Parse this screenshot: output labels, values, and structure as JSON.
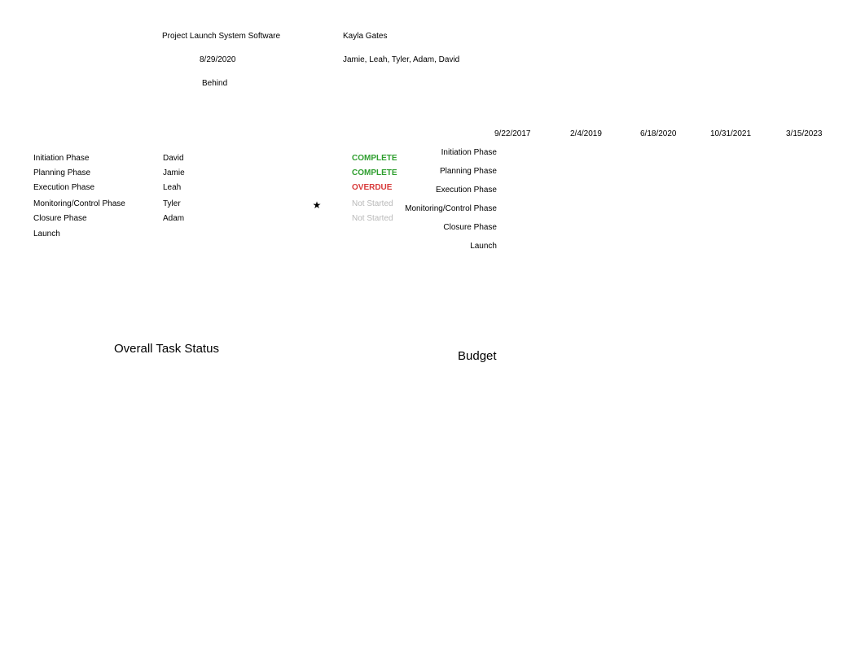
{
  "header": {
    "project_name": "Project Launch System Software",
    "project_date": "8/29/2020",
    "status_label": "Behind",
    "lead": "Kayla Gates",
    "team": "Jamie, Leah, Tyler, Adam, David"
  },
  "tasks": [
    {
      "phase": "Initiation Phase",
      "owner": "David",
      "risk": "",
      "status": "COMPLETE",
      "status_class": "status-complete"
    },
    {
      "phase": "Planning Phase",
      "owner": "Jamie",
      "risk": "",
      "status": "COMPLETE",
      "status_class": "status-complete"
    },
    {
      "phase": "Execution Phase",
      "owner": "Leah",
      "risk": "",
      "status": "OVERDUE",
      "status_class": "status-overdue"
    },
    {
      "phase": "Monitoring/Control Phase",
      "owner": "Tyler",
      "risk": "★",
      "status": "Not Started",
      "status_class": "status-notstarted"
    },
    {
      "phase": "Closure Phase",
      "owner": "Adam",
      "risk": "",
      "status": "Not Started",
      "status_class": "status-notstarted"
    },
    {
      "phase": "Launch",
      "owner": "",
      "risk": "",
      "status": "",
      "status_class": ""
    }
  ],
  "timeline": {
    "dates": [
      "9/22/2017",
      "2/4/2019",
      "6/18/2020",
      "10/31/2021",
      "3/15/2023"
    ],
    "rows": [
      "Initiation Phase",
      "Planning Phase",
      "Execution Phase",
      "Monitoring/Control Phase",
      "Closure Phase",
      "Launch"
    ]
  },
  "charts": {
    "overall_title": "Overall Task Status",
    "budget_title": "Budget"
  },
  "chart_data": [
    {
      "type": "table",
      "title": "Overall Task Status",
      "series": [
        {
          "name": "Initiation Phase",
          "status": "COMPLETE"
        },
        {
          "name": "Planning Phase",
          "status": "COMPLETE"
        },
        {
          "name": "Execution Phase",
          "status": "OVERDUE"
        },
        {
          "name": "Monitoring/Control Phase",
          "status": "Not Started"
        },
        {
          "name": "Closure Phase",
          "status": "Not Started"
        },
        {
          "name": "Launch",
          "status": ""
        }
      ]
    },
    {
      "type": "table",
      "title": "Budget",
      "series": []
    }
  ]
}
